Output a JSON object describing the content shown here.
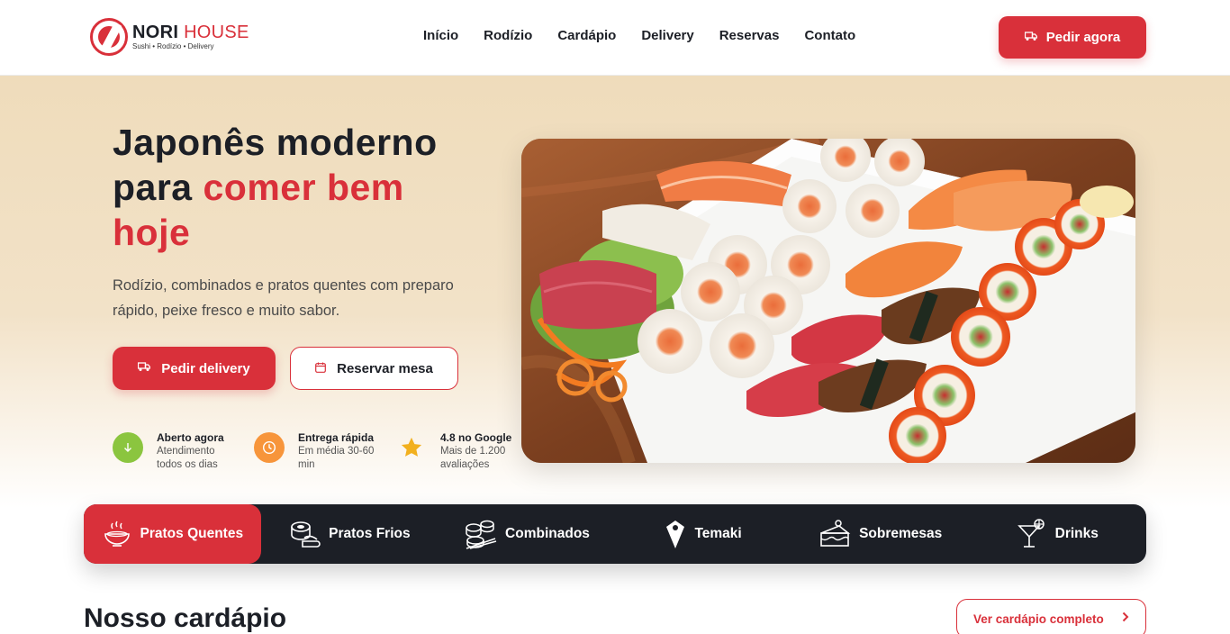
{
  "brand": {
    "name_main": "NORI",
    "name_accent": "HOUSE",
    "tagline": "Sushi • Rodízio • Delivery"
  },
  "nav": {
    "items": [
      "Início",
      "Rodízio",
      "Cardápio",
      "Delivery",
      "Reservas",
      "Contato"
    ]
  },
  "header": {
    "cta_label": "Pedir agora",
    "cta_icon": "delivery-truck-icon"
  },
  "hero": {
    "title_line1": "Japonês moderno",
    "title_line2_plain": "para ",
    "title_line2_accent": "comer bem",
    "title_line3_accent": "hoje",
    "subtitle": "Rodízio, combinados e pratos quentes com preparo rápido, peixe fresco e muito sabor.",
    "primary_button": "Pedir delivery",
    "secondary_button": "Reservar mesa"
  },
  "features": [
    {
      "title": "Aberto agora",
      "desc": "Atendimento todos os dias",
      "icon": "arrow-down-icon",
      "color": "#8bc53f"
    },
    {
      "title": "Entrega rápida",
      "desc": "Em média 30-60 min",
      "icon": "clock-icon",
      "color": "#f7953b"
    },
    {
      "title": "4.8 no Google",
      "desc": "Mais de 1.200 avaliações",
      "icon": "star-icon",
      "color": "#f2b01e"
    }
  ],
  "categories": [
    {
      "label": "Pratos Quentes",
      "icon": "hot-bowl-icon",
      "active": true
    },
    {
      "label": "Pratos Frios",
      "icon": "sushi-roll-icon",
      "active": false
    },
    {
      "label": "Combinados",
      "icon": "combo-rolls-icon",
      "active": false
    },
    {
      "label": "Temaki",
      "icon": "temaki-icon",
      "active": false
    },
    {
      "label": "Sobremesas",
      "icon": "cake-icon",
      "active": false
    },
    {
      "label": "Drinks",
      "icon": "cocktail-icon",
      "active": false
    }
  ],
  "menu_section": {
    "title": "Nosso cardápio",
    "button": "Ver cardápio completo"
  },
  "colors": {
    "accent": "#d9303a",
    "dark": "#1c1f26",
    "hero_bg": "#efdcbb"
  }
}
